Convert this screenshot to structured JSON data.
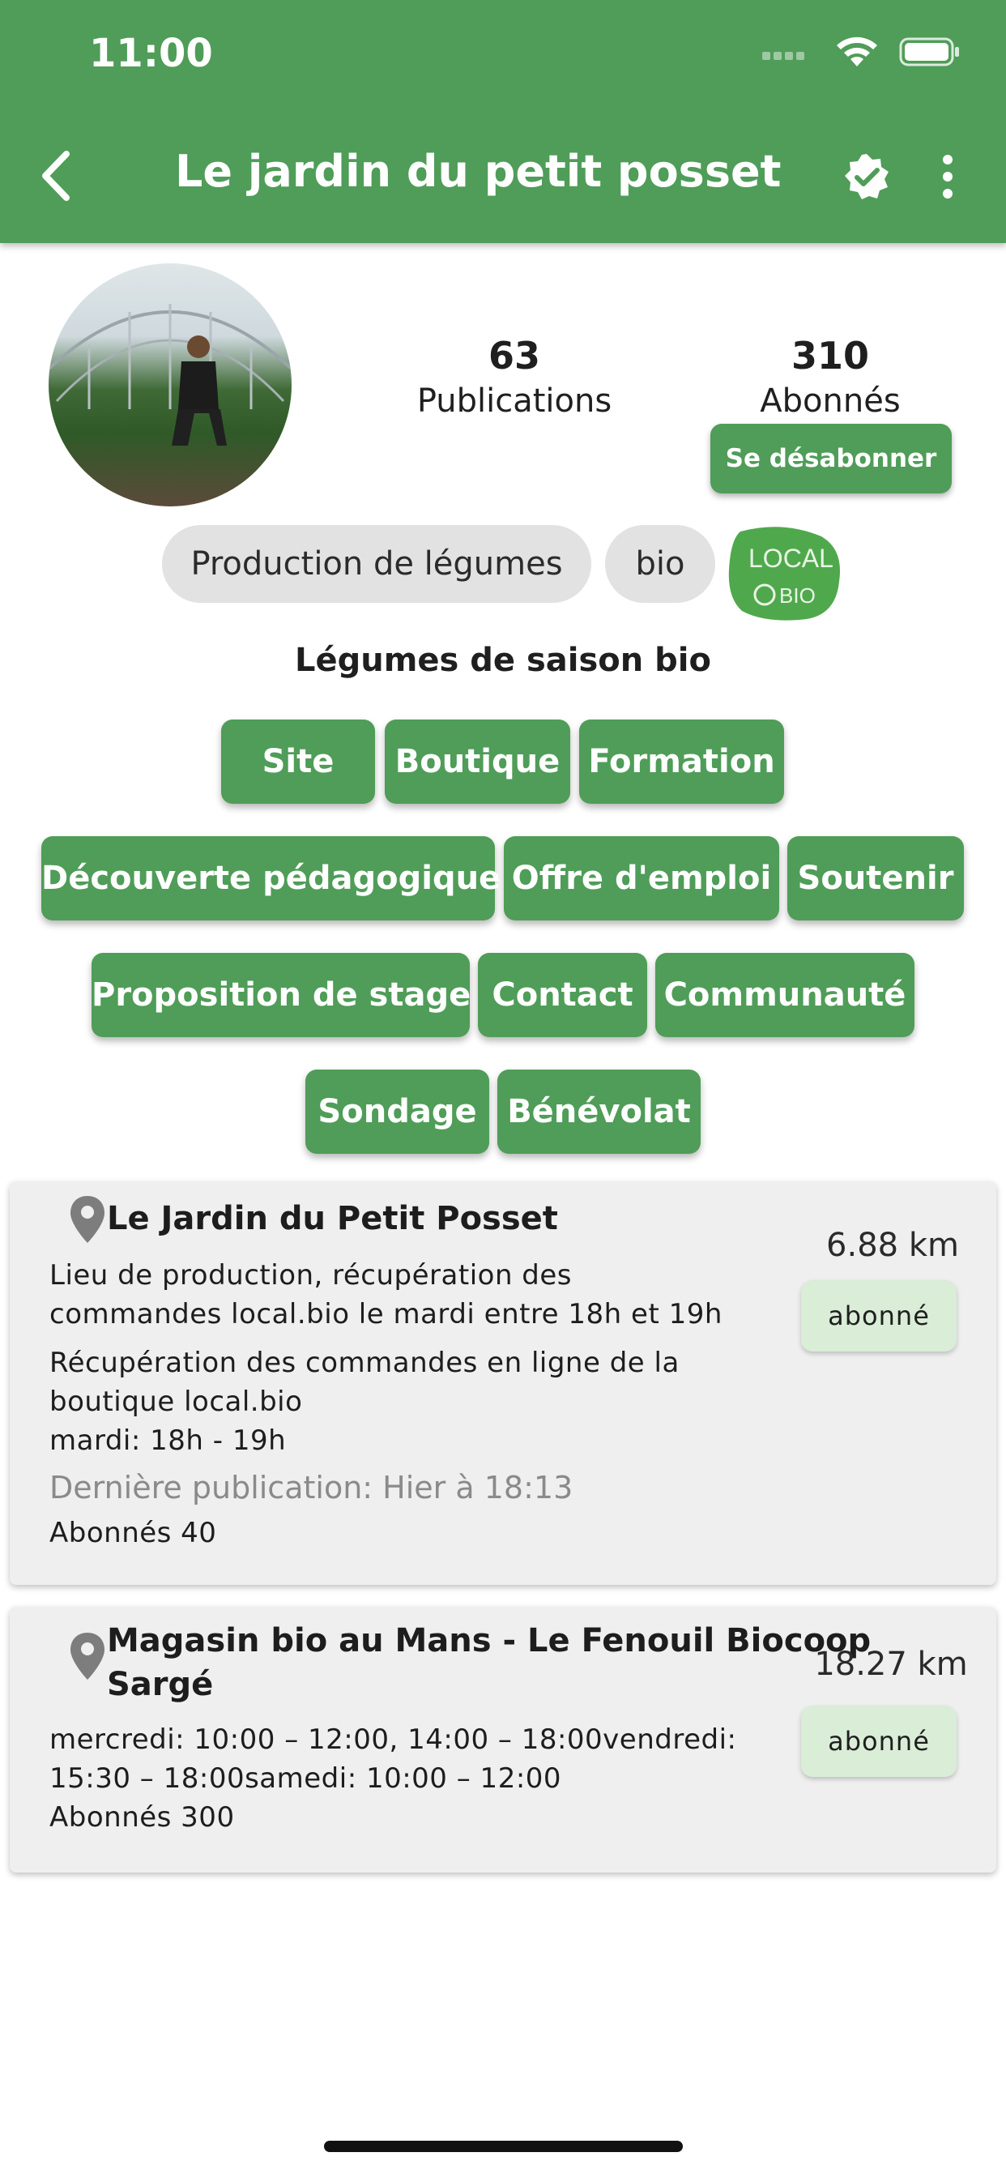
{
  "status_bar": {
    "time": "11:00"
  },
  "header": {
    "title": "Le jardin du petit posset"
  },
  "profile": {
    "publications_count": "63",
    "publications_label": "Publications",
    "subscribers_count": "310",
    "subscribers_label": "Abonnés",
    "unsubscribe_label": "Se désabonner",
    "tags": [
      "Production de légumes",
      "bio"
    ],
    "logo_text": {
      "line1": "LOCAL",
      "line2": "BIO"
    },
    "description": "Légumes de saison bio"
  },
  "links": [
    "Site",
    "Boutique",
    "Formation",
    "Découverte pédagogique",
    "Offre d'emploi",
    "Soutenir",
    "Proposition de stage",
    "Contact",
    "Communauté",
    "Sondage",
    "Bénévolat"
  ],
  "locations": [
    {
      "name": "Le Jardin du Petit Posset",
      "distance": "6.88 km",
      "badge": "abonné",
      "lines": [
        "Lieu de production, récupération des",
        "commandes local.bio le mardi entre 18h et 19h",
        "Récupération des commandes en ligne de la",
        "boutique local.bio",
        "mardi: 18h - 19h"
      ],
      "last_post": "Dernière publication: Hier à 18:13",
      "subscribers": "Abonnés 40"
    },
    {
      "name_lines": [
        "Magasin bio au Mans - Le Fenouil Biocoop",
        "Sargé"
      ],
      "distance": "18.27 km",
      "badge": "abonné",
      "lines": [
        "mercredi: 10:00 – 12:00, 14:00 – 18:00vendredi:",
        "15:30 – 18:00samedi: 10:00 – 12:00"
      ],
      "subscribers": "Abonnés 300"
    }
  ],
  "colors": {
    "primary": "#4f9d58",
    "chip": "#e2e2e2",
    "card": "#efefef",
    "badge": "#d9edd7"
  }
}
